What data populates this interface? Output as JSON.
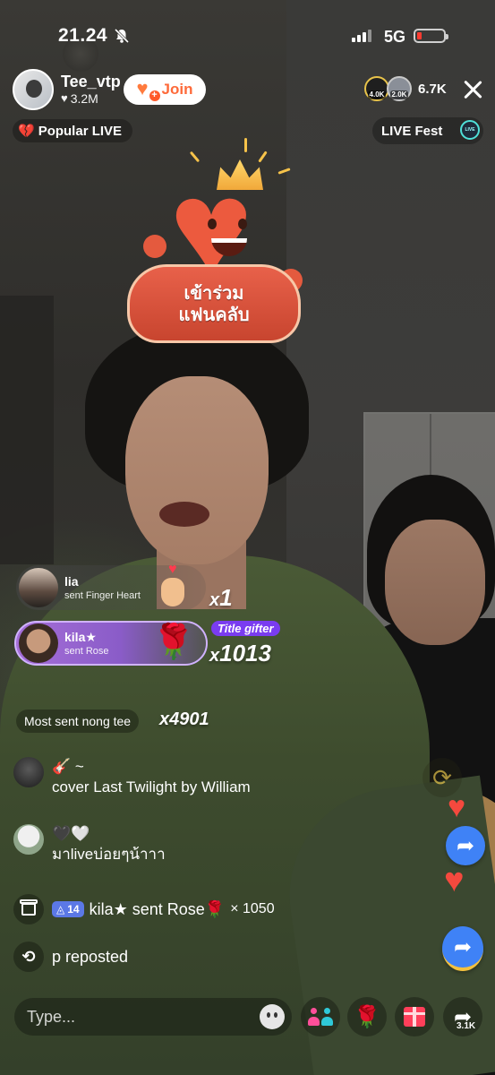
{
  "status_bar": {
    "time": "21.24",
    "network": "5G"
  },
  "host": {
    "name": "Tee_vtp",
    "likes": "3.2M",
    "join_label": "Join"
  },
  "viewers": {
    "avatar_badges": [
      "4.0K",
      "2.0K"
    ],
    "count": "6.7K"
  },
  "badges": {
    "popular": "Popular LIVE",
    "live_fest": "LIVE Fest",
    "live_fest_icon_text": "LIVE"
  },
  "fanclub": {
    "line1": "เข้าร่วม",
    "line2": "แฟนคลับ"
  },
  "gifts": [
    {
      "user": "lia",
      "desc": "sent Finger Heart",
      "combo": "1",
      "icon": "finger-heart-icon"
    },
    {
      "user": "kila★",
      "desc": "sent Rose",
      "combo": "1013",
      "icon": "rose-icon",
      "tag": "Title gifter"
    }
  ],
  "most_sent": {
    "label": "Most sent nong tee",
    "count": "x4901"
  },
  "comments": [
    {
      "emoji": "🎸 ~",
      "text": "cover Last Twilight by William"
    },
    {
      "emoji": "🖤🤍",
      "text": "มาliveบ่อยๆน้าาา"
    }
  ],
  "system_messages": {
    "gift": {
      "level": "14",
      "text": "kila★ sent Rose",
      "multiplier": "× 1050"
    },
    "repost": {
      "text": "p reposted"
    }
  },
  "bottom_bar": {
    "input_placeholder": "Type...",
    "share_count": "3.1K"
  },
  "colors": {
    "join_orange": "#fe6a3a",
    "title_gifter_purple": "#7a3cf0",
    "share_blue": "#3f82f6",
    "level_badge": "#5b78e6"
  }
}
